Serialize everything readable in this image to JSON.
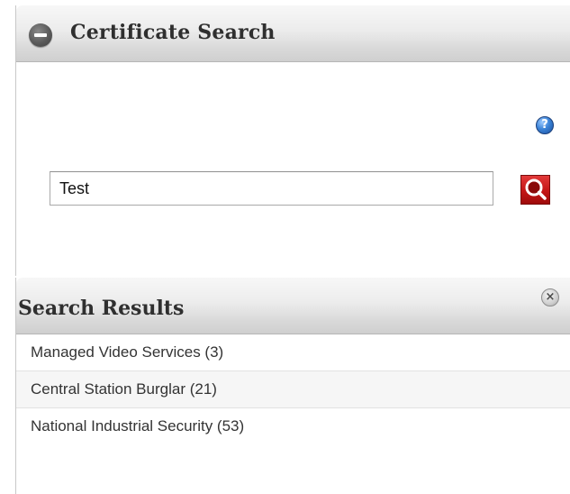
{
  "certificate_search": {
    "title": "Certificate Search",
    "help_icon": "question-mark-icon",
    "help_glyph": "?",
    "collapse_icon": "minus-circle-icon",
    "search_input": {
      "value": "Test",
      "placeholder": ""
    },
    "search_button_icon": "magnifier-icon",
    "accent_color": "#c41616"
  },
  "search_results": {
    "title": "Search Results",
    "close_icon": "close-circle-icon",
    "close_glyph": "×",
    "items": [
      {
        "label": "Managed Video Services (3)"
      },
      {
        "label": "Central Station Burglar (21)"
      },
      {
        "label": "National Industrial Security (53)"
      }
    ]
  }
}
